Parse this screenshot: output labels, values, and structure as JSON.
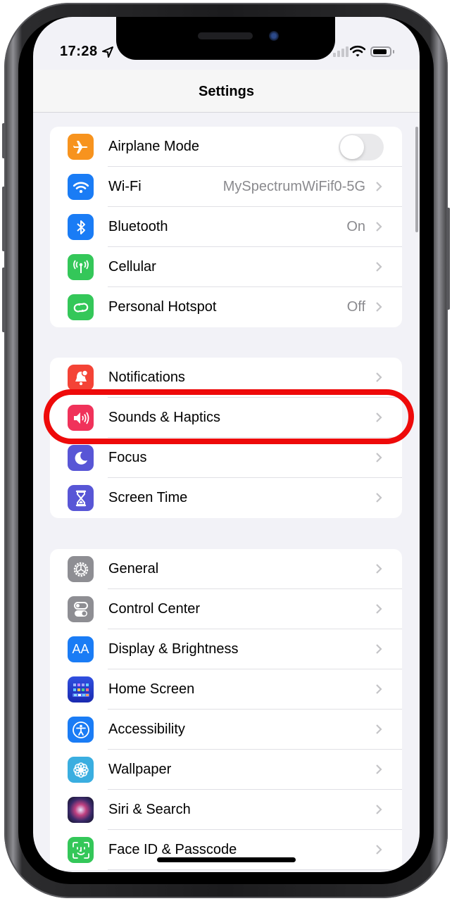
{
  "status_bar": {
    "time": "17:28",
    "location_icon": "location-arrow-icon",
    "signal_icon": "cellular-signal-icon",
    "wifi_icon": "wifi-status-icon",
    "battery_icon": "battery-icon"
  },
  "header": {
    "title": "Settings"
  },
  "groups": [
    {
      "items": [
        {
          "label": "Airplane Mode",
          "icon": "airplane-icon",
          "color": "#f7931e",
          "control": "toggle",
          "toggle_on": false
        },
        {
          "label": "Wi-Fi",
          "icon": "wifi-icon",
          "color": "#1a7cf5",
          "value": "MySpectrumWiFif0-5G"
        },
        {
          "label": "Bluetooth",
          "icon": "bluetooth-icon",
          "color": "#1a7cf5",
          "value": "On"
        },
        {
          "label": "Cellular",
          "icon": "cellular-antenna-icon",
          "color": "#34c759",
          "value": ""
        },
        {
          "label": "Personal Hotspot",
          "icon": "hotspot-link-icon",
          "color": "#34c759",
          "value": "Off"
        }
      ]
    },
    {
      "items": [
        {
          "label": "Notifications",
          "icon": "notification-bell-icon",
          "color": "#f44336"
        },
        {
          "label": "Sounds & Haptics",
          "icon": "speaker-icon",
          "color": "#f0325a",
          "highlighted": true
        },
        {
          "label": "Focus",
          "icon": "moon-icon",
          "color": "#5856d6"
        },
        {
          "label": "Screen Time",
          "icon": "hourglass-icon",
          "color": "#5856d6"
        }
      ]
    },
    {
      "items": [
        {
          "label": "General",
          "icon": "gear-icon",
          "color": "#8e8e93"
        },
        {
          "label": "Control Center",
          "icon": "switches-icon",
          "color": "#8e8e93"
        },
        {
          "label": "Display & Brightness",
          "icon": "text-size-icon",
          "color": "#1a7cf5",
          "icon_text": "AA"
        },
        {
          "label": "Home Screen",
          "icon": "app-grid-icon",
          "color": "#2a3fd0"
        },
        {
          "label": "Accessibility",
          "icon": "accessibility-icon",
          "color": "#1a7cf5"
        },
        {
          "label": "Wallpaper",
          "icon": "flower-icon",
          "color": "#3aaee0"
        },
        {
          "label": "Siri & Search",
          "icon": "siri-icon",
          "color": "#1a1a2e"
        },
        {
          "label": "Face ID & Passcode",
          "icon": "face-id-icon",
          "color": "#34c759"
        }
      ]
    }
  ],
  "annotation": {
    "highlight_color": "#ee0a0a",
    "highlighted_item": "Sounds & Haptics"
  }
}
